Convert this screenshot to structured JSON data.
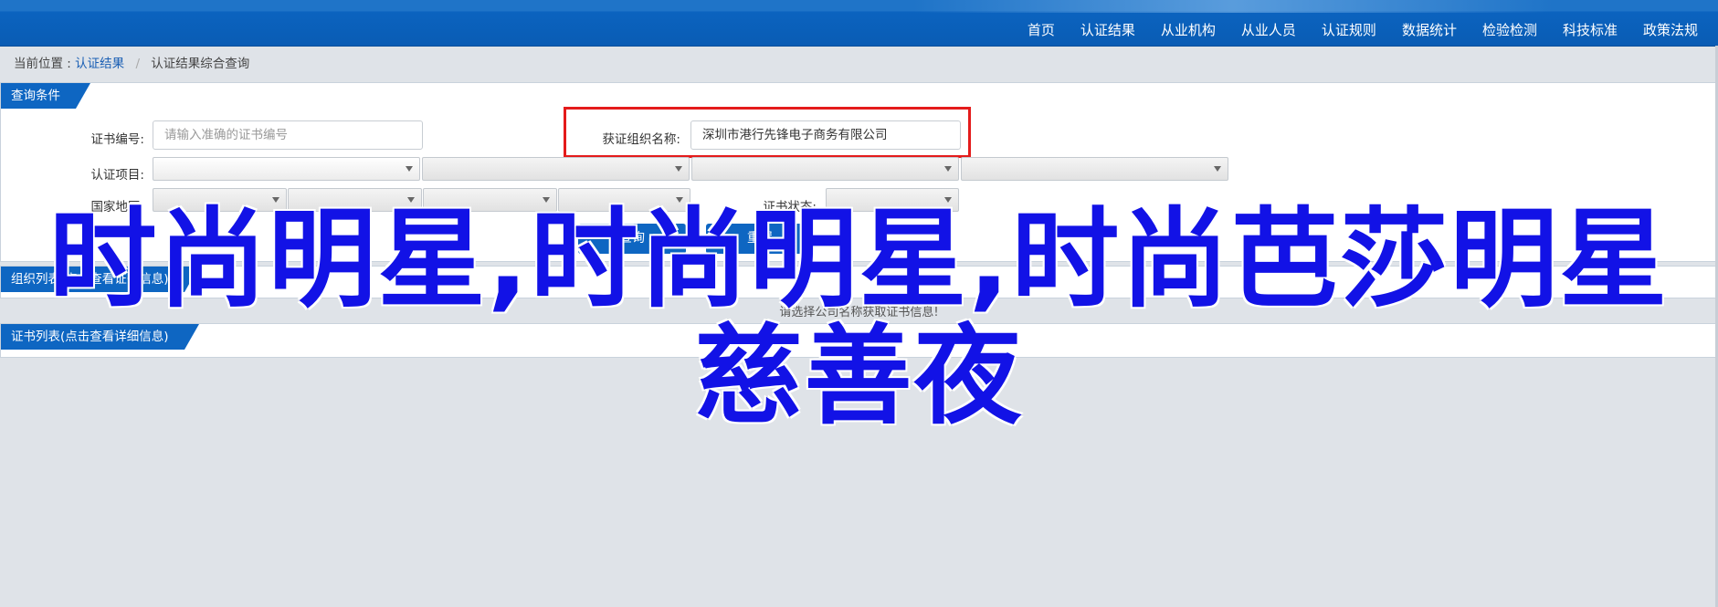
{
  "nav": {
    "items": [
      "首页",
      "认证结果",
      "从业机构",
      "从业人员",
      "认证规则",
      "数据统计",
      "检验检测",
      "科技标准",
      "政策法规"
    ]
  },
  "breadcrumb": {
    "prefix": "当前位置 :",
    "link": "认证结果",
    "separator": "/",
    "current": "认证结果综合查询"
  },
  "query_panel": {
    "title": "查询条件",
    "cert_no_label": "证书编号:",
    "cert_no_placeholder": "请输入准确的证书编号",
    "org_label": "获证组织名称:",
    "org_value": "深圳市港行先锋电子商务有限公司",
    "project_label": "认证项目:",
    "region_label": "国家地区:",
    "status_label": "证书状态:",
    "search_button": "查询",
    "reset_button": "重置"
  },
  "group_panel": {
    "title": "组织列表(点击查看证书信息)"
  },
  "notice": "请选择公司名称获取证书信息!",
  "cert_panel": {
    "title": "证书列表(点击查看详细信息)"
  },
  "overlay": {
    "line1": "时尚明星,时尚明星,时尚芭莎明星",
    "line2": "慈善夜"
  },
  "colors": {
    "nav_bg": "#0b63bf",
    "tab_bg": "#0e66c2",
    "highlight": "#e41b1b",
    "overlay_text": "#1212e6"
  }
}
